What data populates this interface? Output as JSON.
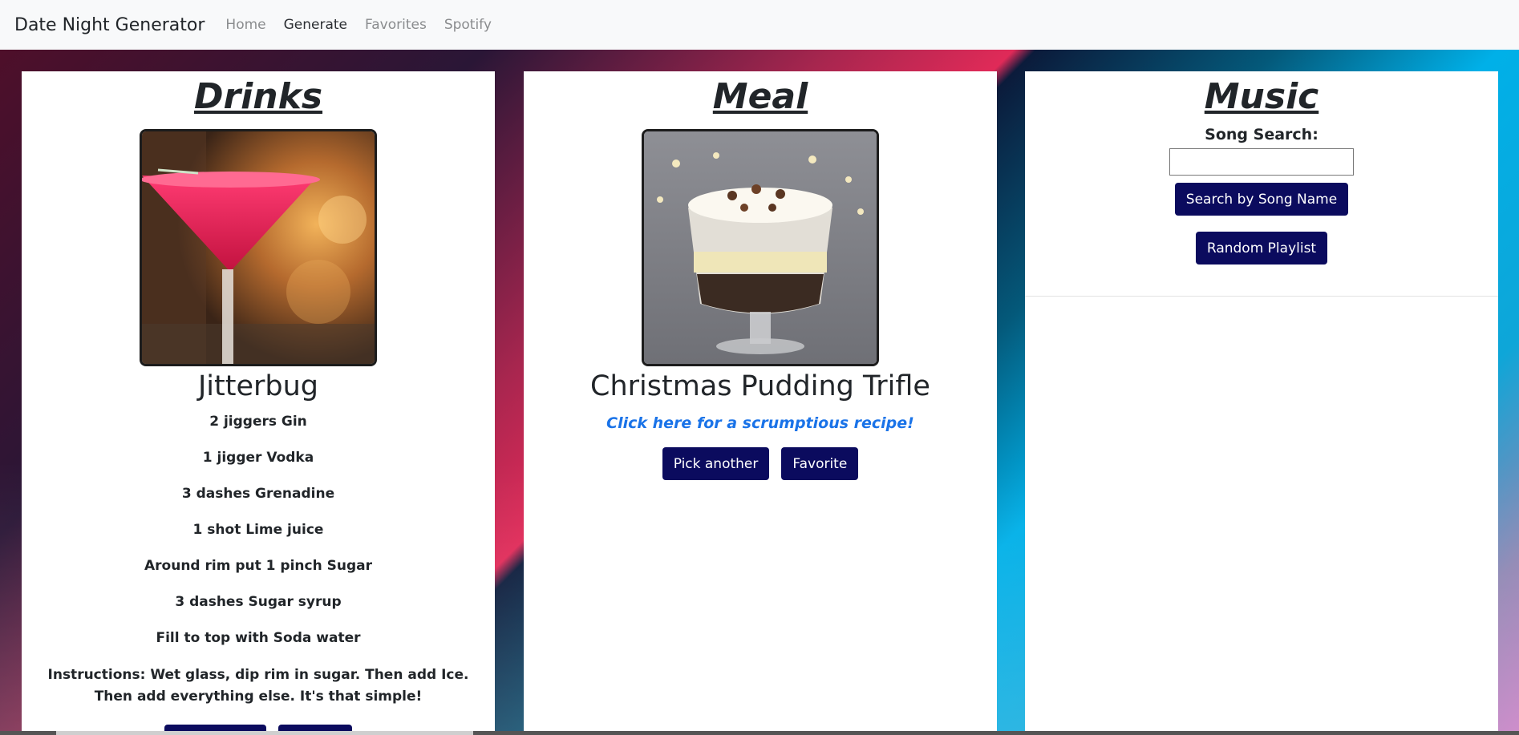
{
  "navbar": {
    "brand": "Date Night Generator",
    "links": [
      "Home",
      "Generate",
      "Favorites",
      "Spotify"
    ],
    "active": "Generate"
  },
  "drinks": {
    "title": "Drinks",
    "name": "Jitterbug",
    "ingredients": [
      "2 jiggers Gin",
      "1 jigger Vodka",
      "3 dashes Grenadine",
      "1 shot Lime juice",
      "Around rim put 1 pinch Sugar",
      "3 dashes Sugar syrup",
      "Fill to top with Soda water"
    ],
    "instructions": "Instructions: Wet glass, dip rim in sugar. Then add Ice. Then add everything else. It's that simple!",
    "image_icon": "cocktail-photo"
  },
  "meal": {
    "title": "Meal",
    "name": "Christmas Pudding Trifle",
    "recipe_link": "Click here for a scrumptious recipe!",
    "pick_another_label": "Pick another",
    "favorite_label": "Favorite",
    "image_icon": "trifle-photo"
  },
  "music": {
    "title": "Music",
    "search_label": "Song Search:",
    "search_value": "",
    "search_button_label": "Search by Song Name",
    "random_button_label": "Random Playlist"
  },
  "colors": {
    "button": "#0b0b5e",
    "link": "#1a73e8",
    "navbar": "#f8f9fa"
  }
}
